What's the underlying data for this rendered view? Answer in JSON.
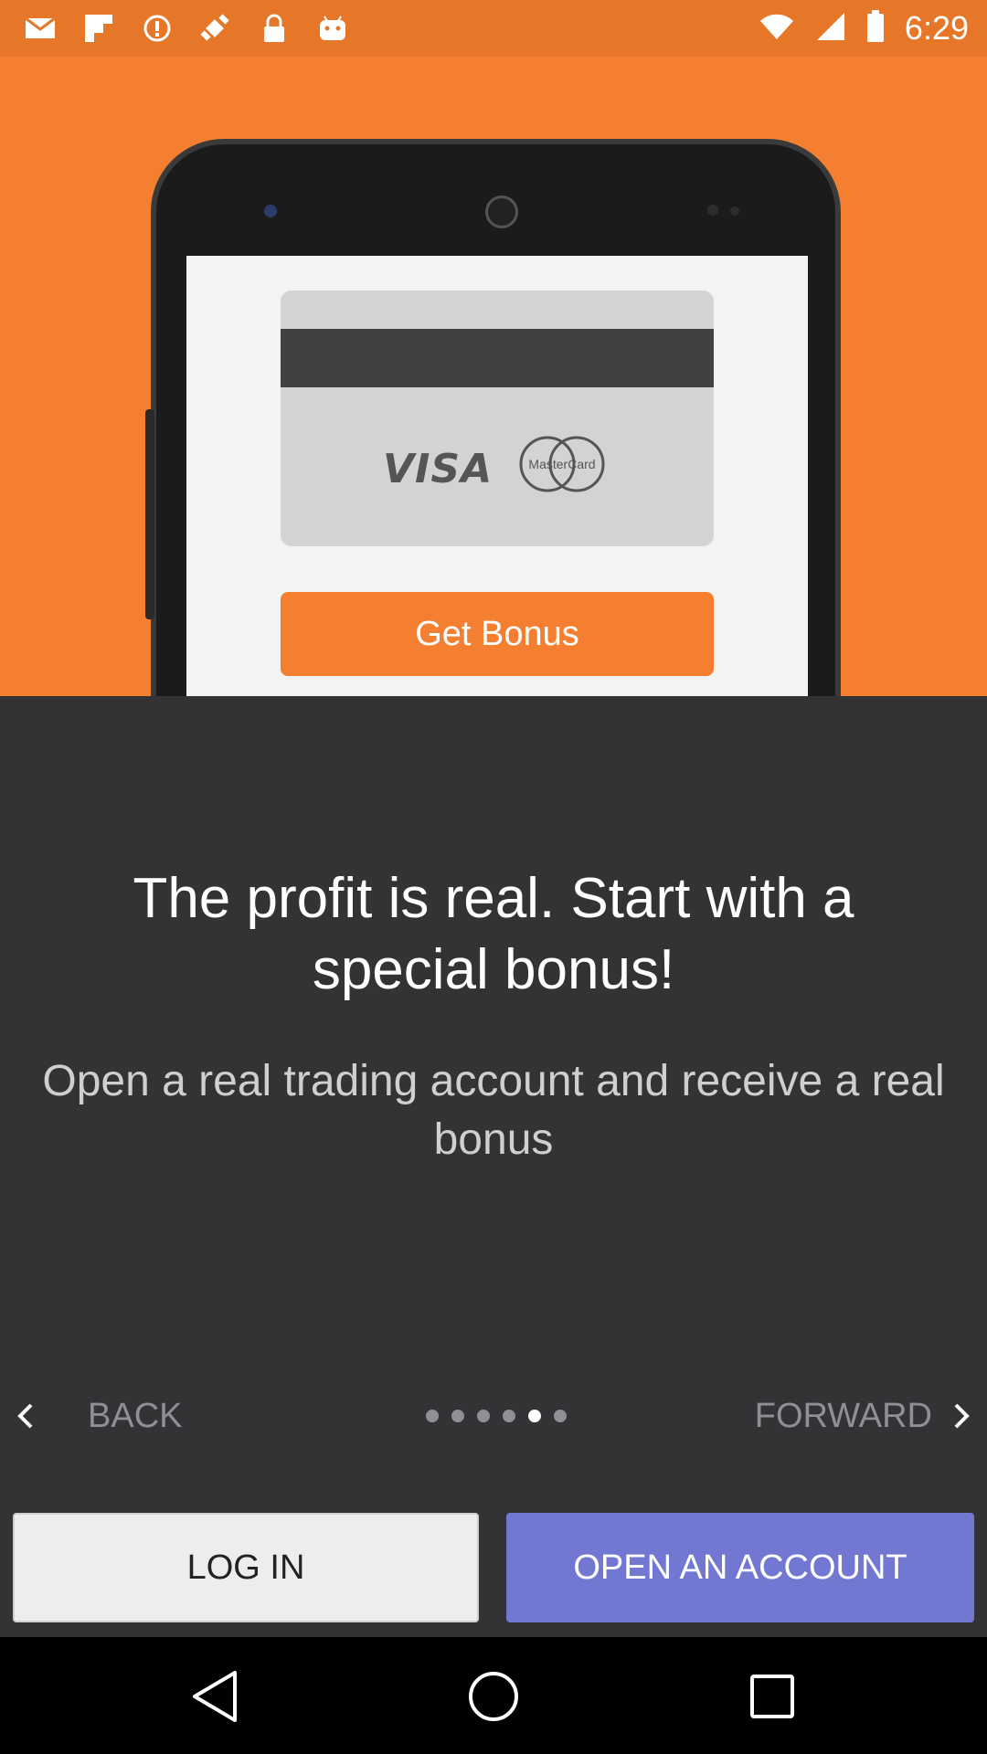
{
  "status_bar": {
    "time": "6:29",
    "icons": [
      "mail-icon",
      "flipboard-icon",
      "hazard-icon",
      "fake-gps-icon",
      "lock-icon",
      "android-icon",
      "wifi-icon",
      "cellular-icon",
      "battery-icon"
    ]
  },
  "hero": {
    "card_logos": [
      "VISA",
      "MasterCard"
    ],
    "cta_label": "Get Bonus"
  },
  "content": {
    "headline": "The profit is real. Start with a special bonus!",
    "subline": "Open a real trading account and receive a real bonus"
  },
  "pager": {
    "back_label": "BACK",
    "forward_label": "FORWARD",
    "total_pages": 6,
    "current_page": 5
  },
  "actions": {
    "login_label": "LOG IN",
    "open_account_label": "OPEN AN ACCOUNT"
  },
  "colors": {
    "hero_orange": "#f47f30",
    "background": "#333336",
    "primary_button": "#7278d2"
  },
  "system_nav": [
    "back-icon",
    "home-icon",
    "recents-icon"
  ]
}
